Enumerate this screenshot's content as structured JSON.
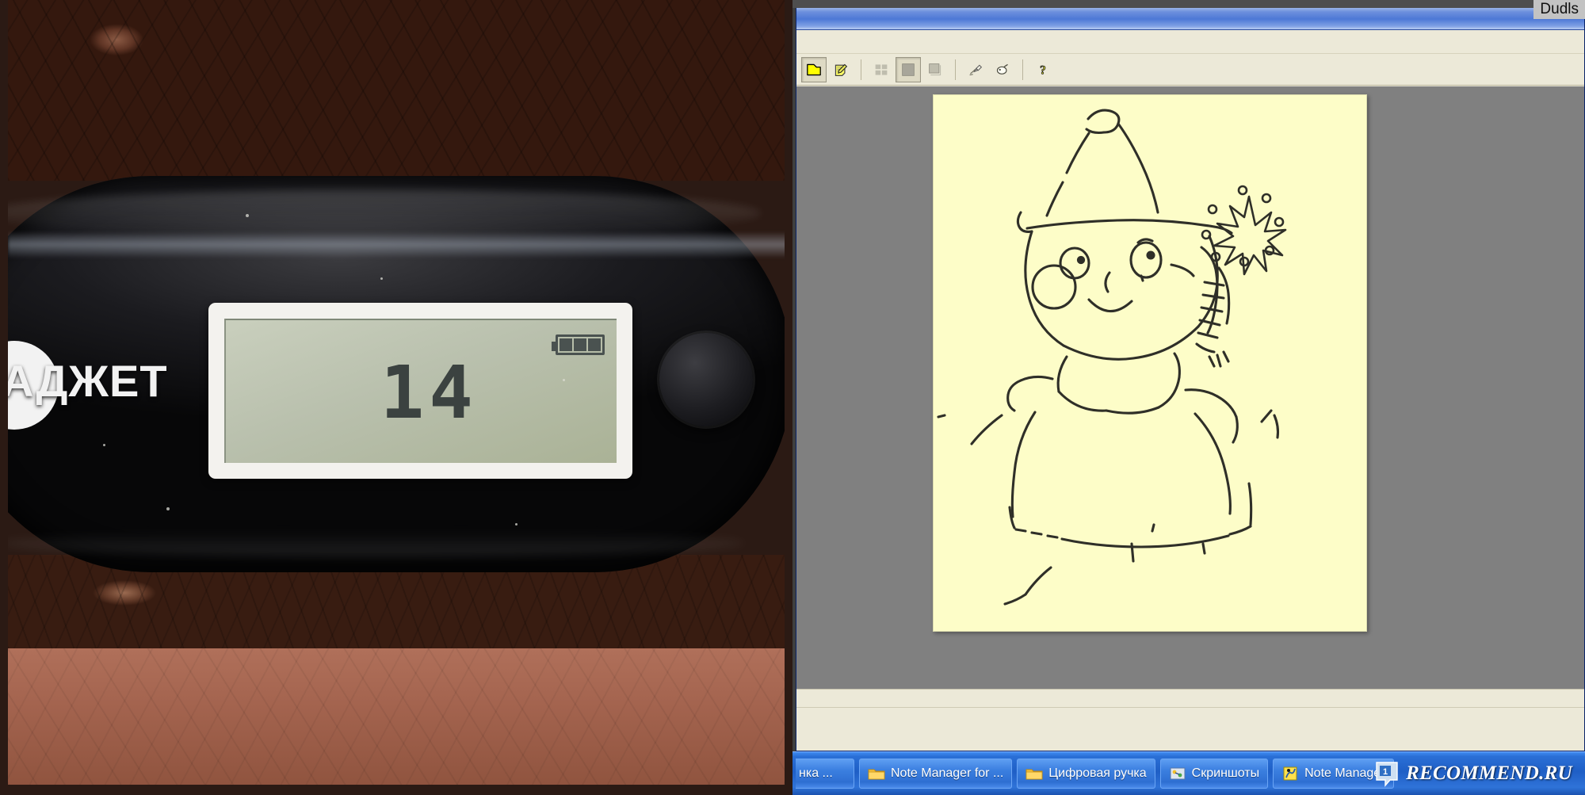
{
  "left_photo": {
    "device_brand_text": "АДЖЕТ",
    "lcd_value": "14",
    "battery_bars": 3,
    "description_name": "pedometer-photo"
  },
  "app_window": {
    "tooltip_label": "Dudls",
    "title": "",
    "toolbar": {
      "buttons": [
        {
          "name": "new-page-icon",
          "label": "New page",
          "pressed": true
        },
        {
          "name": "note-pen-icon",
          "label": "Note",
          "pressed": false
        },
        {
          "name": "thumbnail-grid-icon",
          "label": "Thumbnails",
          "pressed": false
        },
        {
          "name": "single-page-icon",
          "label": "Single page",
          "pressed": true
        },
        {
          "name": "page-shadow-icon",
          "label": "Page view",
          "pressed": false
        },
        {
          "name": "pen-write-icon",
          "label": "Pen",
          "pressed": false
        },
        {
          "name": "hand-pointer-icon",
          "label": "Hand",
          "pressed": false
        },
        {
          "name": "help-question-icon",
          "label": "Help",
          "pressed": false
        }
      ]
    },
    "canvas": {
      "page_background_color": "#fdfdc8",
      "workspace_background_color": "#808080",
      "drawing_title": "hand-drawn snowman child with hat, scarf and snowflake",
      "ink_color": "#2f2f28"
    },
    "statusbar_text": ""
  },
  "taskbar": {
    "items": [
      {
        "label": "нка ...",
        "icon": "folder-icon",
        "clipped": true
      },
      {
        "label": "Note Manager for ...",
        "icon": "folder-icon",
        "clipped": false
      },
      {
        "label": "Цифровая ручка",
        "icon": "folder-icon",
        "clipped": false
      },
      {
        "label": "Скриншоты",
        "icon": "screenshots-icon",
        "clipped": false
      },
      {
        "label": "Note Manager",
        "icon": "note-manager-icon",
        "clipped": false
      }
    ]
  },
  "watermark": {
    "text": "RECOMMEND.RU"
  },
  "colors": {
    "titlebar_blue": "#4d78d6",
    "taskbar_blue": "#1f5fc6",
    "chrome_beige": "#ece9d8",
    "canvas_gray": "#808080",
    "page_yellow": "#fdfdc8"
  }
}
